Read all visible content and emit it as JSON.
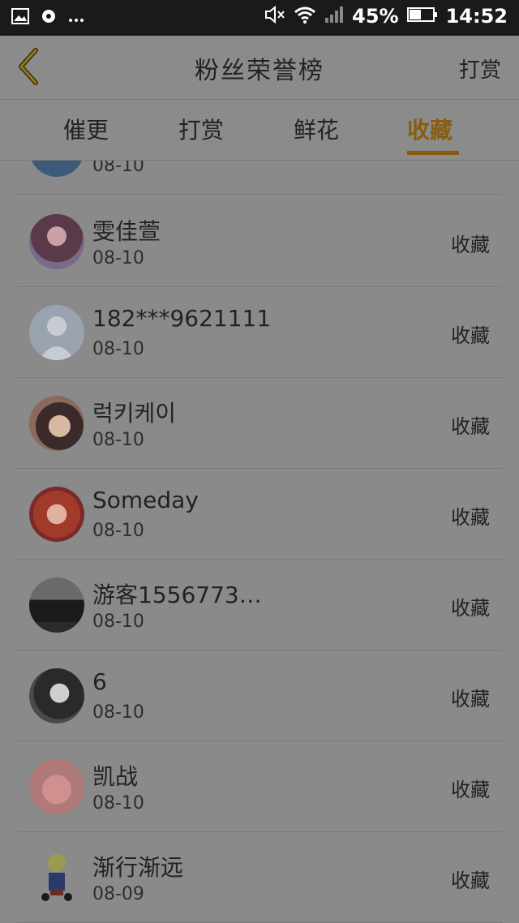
{
  "status_bar": {
    "battery": "45%",
    "time": "14:52",
    "icons": [
      "image-icon",
      "notification-icon",
      "more-icon",
      "mute-icon",
      "wifi-icon",
      "signal-icon",
      "battery-icon"
    ]
  },
  "header": {
    "title": "粉丝荣誉榜",
    "right_action": "打赏"
  },
  "tabs": [
    {
      "label": "催更"
    },
    {
      "label": "打赏"
    },
    {
      "label": "鲜花"
    },
    {
      "label": "收藏"
    }
  ],
  "active_tab": "收藏",
  "rows": [
    {
      "name": "",
      "date": "08-10",
      "action": "",
      "avatar_color": "#3d5a7a"
    },
    {
      "name": "雯佳萱",
      "date": "08-10",
      "action": "收藏",
      "avatar_color": "#6b4a5a"
    },
    {
      "name": "182***9621111",
      "date": "08-10",
      "action": "收藏",
      "avatar_color": "#9aa3b0"
    },
    {
      "name": "럭키케이",
      "date": "08-10",
      "action": "收藏",
      "avatar_color": "#8a6a5a"
    },
    {
      "name": "Someday",
      "date": "08-10",
      "action": "收藏",
      "avatar_color": "#a04a3a"
    },
    {
      "name": "游客1556773…",
      "date": "08-10",
      "action": "收藏",
      "avatar_color": "#3a3a3a"
    },
    {
      "name": "6",
      "date": "08-10",
      "action": "收藏",
      "avatar_color": "#555555"
    },
    {
      "name": "凯战",
      "date": "08-10",
      "action": "收藏",
      "avatar_color": "#b07a78"
    },
    {
      "name": "渐行渐远",
      "date": "08-09",
      "action": "收藏",
      "avatar_color": "#8a8a8a"
    }
  ],
  "colors": {
    "accent": "#8a5c10",
    "overlay_bg": "#8a8a8a"
  }
}
